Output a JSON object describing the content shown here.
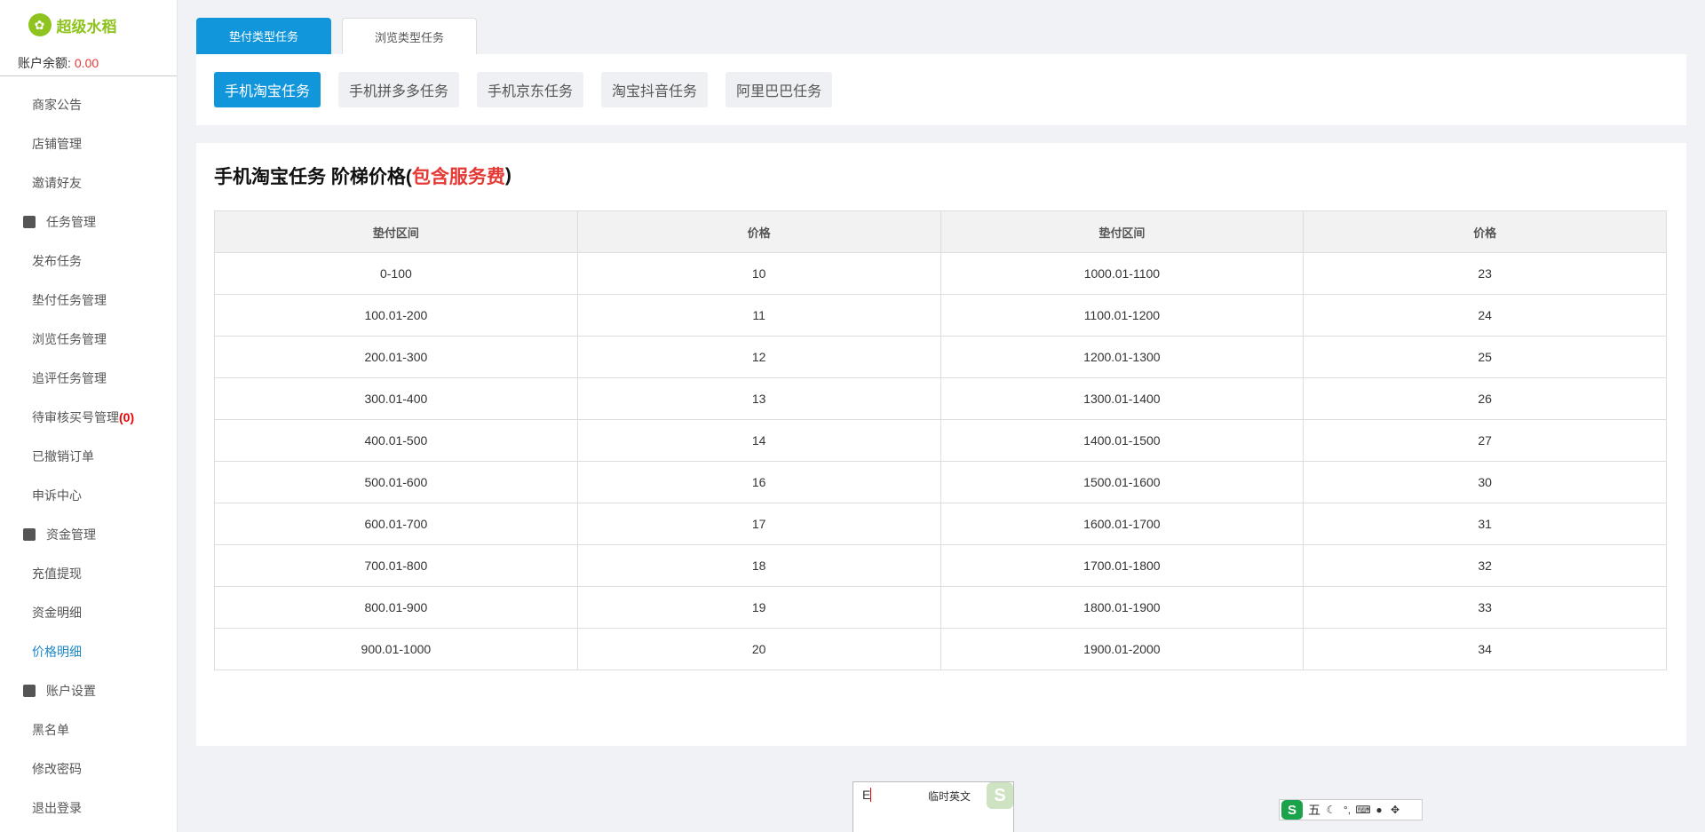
{
  "logo": {
    "text": "超级水稻"
  },
  "account": {
    "label": "账户余额:",
    "value": "0.00"
  },
  "sidebar": {
    "items": [
      {
        "label": "商家公告",
        "type": "item"
      },
      {
        "label": "店铺管理",
        "type": "item"
      },
      {
        "label": "邀请好友",
        "type": "item"
      },
      {
        "label": "任务管理",
        "type": "group"
      },
      {
        "label": "发布任务",
        "type": "item"
      },
      {
        "label": "垫付任务管理",
        "type": "item"
      },
      {
        "label": "浏览任务管理",
        "type": "item"
      },
      {
        "label": "追评任务管理",
        "type": "item"
      },
      {
        "label": "待审核买号管理",
        "type": "item",
        "badge": "(0)"
      },
      {
        "label": "已撤销订单",
        "type": "item"
      },
      {
        "label": "申诉中心",
        "type": "item"
      },
      {
        "label": "资金管理",
        "type": "group"
      },
      {
        "label": "充值提现",
        "type": "item"
      },
      {
        "label": "资金明细",
        "type": "item"
      },
      {
        "label": "价格明细",
        "type": "item",
        "active": true
      },
      {
        "label": "账户设置",
        "type": "group"
      },
      {
        "label": "黑名单",
        "type": "item"
      },
      {
        "label": "修改密码",
        "type": "item"
      },
      {
        "label": "退出登录",
        "type": "item"
      }
    ]
  },
  "tabs": [
    {
      "label": "垫付类型任务",
      "active": true
    },
    {
      "label": "浏览类型任务",
      "active": false
    }
  ],
  "subtabs": [
    {
      "label": "手机淘宝任务",
      "active": true
    },
    {
      "label": "手机拼多多任务",
      "active": false
    },
    {
      "label": "手机京东任务",
      "active": false
    },
    {
      "label": "淘宝抖音任务",
      "active": false
    },
    {
      "label": "阿里巴巴任务",
      "active": false
    }
  ],
  "panel": {
    "title_main": "手机淘宝任务 阶梯价格(",
    "title_red": "包含服务费",
    "title_close": ")"
  },
  "table": {
    "headers": [
      "垫付区间",
      "价格",
      "垫付区间",
      "价格"
    ],
    "rows": [
      [
        "0-100",
        "10",
        "1000.01-1100",
        "23"
      ],
      [
        "100.01-200",
        "11",
        "1100.01-1200",
        "24"
      ],
      [
        "200.01-300",
        "12",
        "1200.01-1300",
        "25"
      ],
      [
        "300.01-400",
        "13",
        "1300.01-1400",
        "26"
      ],
      [
        "400.01-500",
        "14",
        "1400.01-1500",
        "27"
      ],
      [
        "500.01-600",
        "16",
        "1500.01-1600",
        "30"
      ],
      [
        "600.01-700",
        "17",
        "1600.01-1700",
        "31"
      ],
      [
        "700.01-800",
        "18",
        "1700.01-1800",
        "32"
      ],
      [
        "800.01-900",
        "19",
        "1800.01-1900",
        "33"
      ],
      [
        "900.01-1000",
        "20",
        "1900.01-2000",
        "34"
      ]
    ]
  },
  "ime": {
    "input": "E",
    "hint": "临时英文",
    "bar_logo": "S",
    "bar_mode": "五"
  },
  "colors": {
    "accent": "#1296db",
    "brand": "#8fc31f",
    "alert": "#e53935"
  }
}
